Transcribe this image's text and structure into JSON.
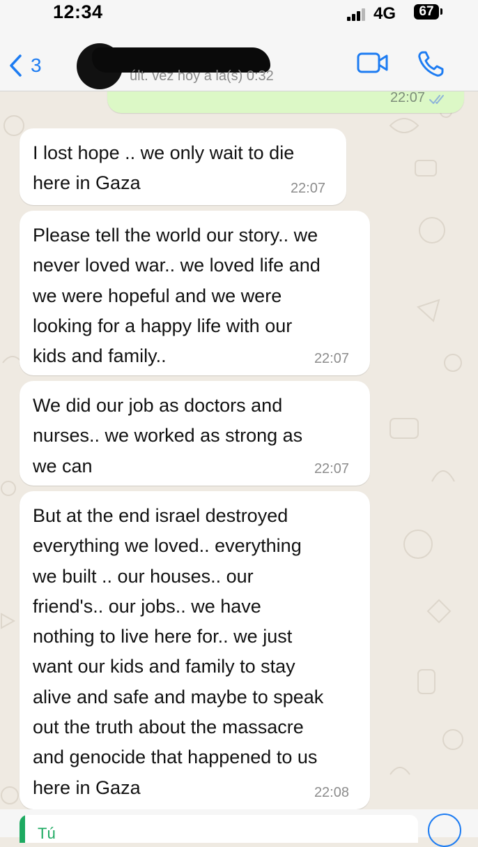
{
  "status_bar": {
    "time": "12:34",
    "network": "4G",
    "battery": "67"
  },
  "header": {
    "back_count": "3",
    "last_seen": "últ. vez hoy a la(s) 0:32",
    "video_icon": "video-camera-icon",
    "call_icon": "phone-icon"
  },
  "messages": {
    "outgoing": {
      "time": "22:07",
      "status_icon": "double-check-icon"
    },
    "incoming": [
      {
        "text": "I lost hope .. we only wait to die\nhere in Gaza",
        "time": "22:07"
      },
      {
        "text": "Please tell the world our story.. we\nnever loved war.. we loved life and\nwe were hopeful and we were\nlooking for a happy life with our\nkids and family..",
        "time": "22:07"
      },
      {
        "text": "We did our job as doctors and\nnurses.. we worked as strong as\nwe can",
        "time": "22:07"
      },
      {
        "text": "But at the end israel destroyed\neverything we loved.. everything\nwe built .. our houses.. our\nfriend's.. our jobs.. we have\nnothing to live here for.. we just\nwant our kids and family to stay\nalive and safe and maybe to speak\nout the truth about the massacre\nand genocide that happened to us\nhere in Gaza",
        "time": "22:08"
      }
    ]
  },
  "composer": {
    "reply_preview": "Tú"
  },
  "colors": {
    "accent_blue": "#1d7cf2",
    "outgoing_bubble": "#dcf8c6",
    "incoming_bubble": "#ffffff",
    "wallpaper": "#efeae2",
    "reply_green": "#1daa61"
  }
}
